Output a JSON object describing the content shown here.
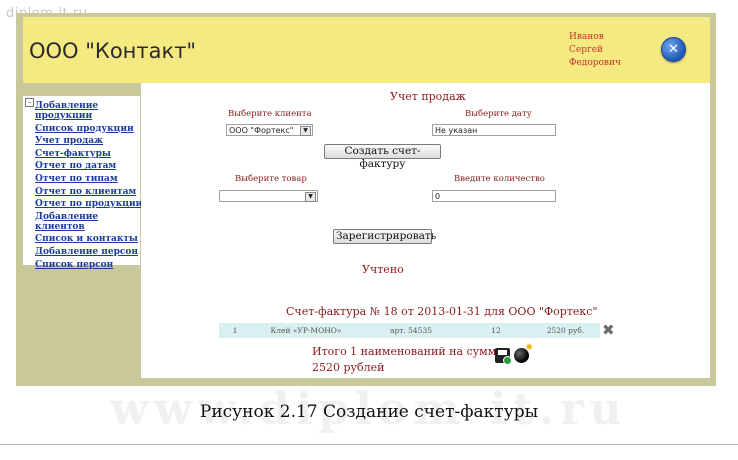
{
  "watermark": {
    "site": "diplom-it.ru",
    "big": "www.diplom-it.ru"
  },
  "header": {
    "title": "ООО \"Контакт\"",
    "user_last": "Иванов",
    "user_first": "Сергей",
    "user_middle": "Федорович",
    "close_icon": "close-icon",
    "close_glyph": "✕"
  },
  "sidebar": {
    "tree_glyph": "–",
    "items": [
      "Добавление продукции",
      "Список продукции",
      "Учет продаж",
      "Счет-фактуры",
      "Отчет по датам",
      "Отчет по типам",
      "Отчет по клиентам",
      "Отчет по продукции",
      "Добавление клиентов",
      "Список и контакты",
      "Добавление персон",
      "Список персон"
    ]
  },
  "main": {
    "title": "Учет продаж",
    "client_label": "Выберите клиента",
    "client_value": "ООО \"Фортекс\"",
    "date_label": "Выберите дату",
    "date_value": "Не указан",
    "create_invoice_button": "Создать счет-фактуру",
    "product_label": "Выберите товар",
    "product_value": "",
    "quantity_label": "Введите количество",
    "quantity_value": "0",
    "register_button": "Зарегистрировать",
    "status": "Учтено",
    "invoice_title": "Счет-фактура № 18 от 2013-01-31 для ООО \"Фортекс\"",
    "invoice_row": [
      "1",
      "Клей «УР-МОНО»",
      "арт. 54535",
      "12",
      "2520 руб."
    ],
    "total_line": "Итого 1 наименований на сумму:",
    "total_amount": "2520 рублей",
    "dropdown_glyph": "▼",
    "delete_glyph": "✖",
    "spark_glyph": "✸"
  },
  "caption": "Рисунок 2.17 Создание счет-фактуры",
  "colors": {
    "header_bg": "#f5e981",
    "frame_bg": "#c9c89a",
    "link": "#1a3c9a",
    "text_red": "#8b1a1a",
    "row_bg": "#d9eff0"
  }
}
